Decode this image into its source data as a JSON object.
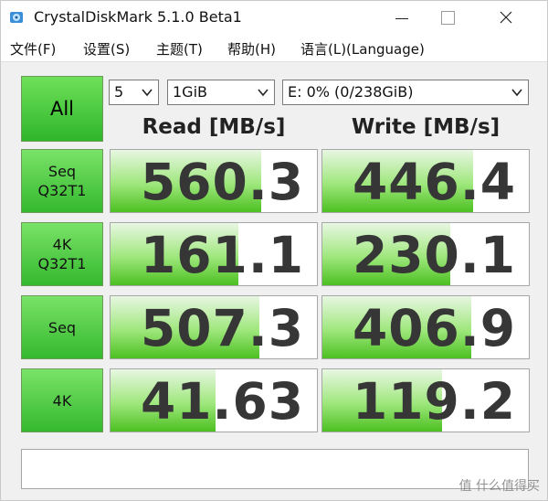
{
  "window": {
    "title": "CrystalDiskMark 5.1.0 Beta1"
  },
  "menu": [
    "文件(F)",
    "设置(S)",
    "主题(T)",
    "帮助(H)",
    "语言(L)(Language)"
  ],
  "controls": {
    "all_label": "All",
    "count": "5",
    "size": "1GiB",
    "drive": "E: 0% (0/238GiB)"
  },
  "headers": {
    "read": "Read [MB/s]",
    "write": "Write [MB/s]"
  },
  "rows": [
    {
      "line1": "Seq",
      "line2": "Q32T1",
      "read": "560.3",
      "write": "446.4",
      "read_fill": 0.73,
      "write_fill": 0.73
    },
    {
      "line1": "4K",
      "line2": "Q32T1",
      "read": "161.1",
      "write": "230.1",
      "read_fill": 0.62,
      "write_fill": 0.62
    },
    {
      "line1": "Seq",
      "line2": "",
      "read": "507.3",
      "write": "406.9",
      "read_fill": 0.72,
      "write_fill": 0.72
    },
    {
      "line1": "4K",
      "line2": "",
      "read": "41.63",
      "write": "119.2",
      "read_fill": 0.51,
      "write_fill": 0.58
    }
  ],
  "comment": "",
  "watermark": "值 什么值得买",
  "colors": {
    "button_green": "#34b92e",
    "bar_green": "#4cc021",
    "value_text": "#363636"
  }
}
